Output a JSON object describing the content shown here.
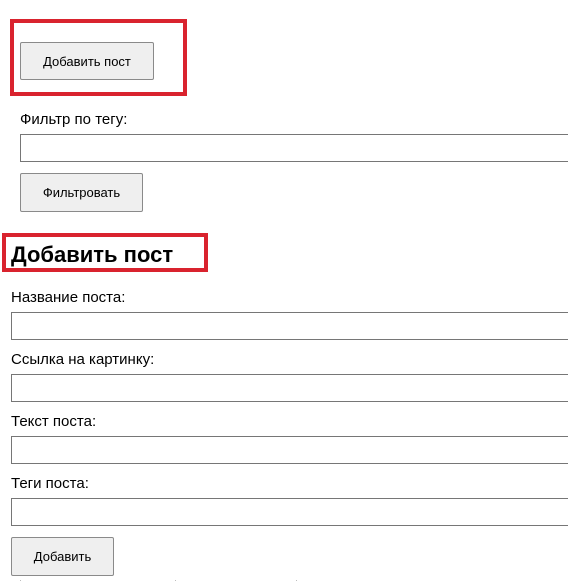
{
  "toolbar": {
    "add_post_label": "Добавить пост"
  },
  "filter": {
    "label": "Фильтр по тегу:",
    "input_value": "",
    "button_label": "Фильтровать"
  },
  "form": {
    "heading": "Добавить пост",
    "title_label": "Название поста:",
    "title_value": "",
    "image_label": "Ссылка на картинку:",
    "image_value": "",
    "text_label": "Текст поста:",
    "text_value": "",
    "tags_label": "Теги поста:",
    "tags_value": "",
    "submit_label": "Добавить"
  },
  "colors": {
    "highlight": "#d9232e",
    "button_bg": "#efefef"
  }
}
